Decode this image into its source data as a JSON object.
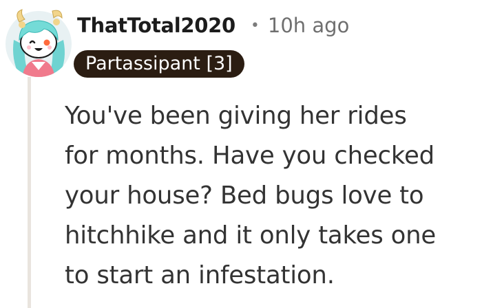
{
  "comment": {
    "username": "ThatTotal2020",
    "separator": "•",
    "timestamp": "10h ago",
    "flair": "Partassipant [3]",
    "avatar_icon": "snoo-avatar-icon",
    "body_lines": [
      "You've been giving her rides",
      "for months. Have you checked",
      "your house? Bed bugs love to",
      "hitchhike and it only takes one",
      "to start an infestation."
    ]
  },
  "colors": {
    "flair_background": "#2b1d12",
    "flair_text": "#ffffff",
    "username": "#1c1c1c",
    "timestamp": "#6f6f6f",
    "body_text": "#333333",
    "thread_line": "#e9e4de"
  }
}
